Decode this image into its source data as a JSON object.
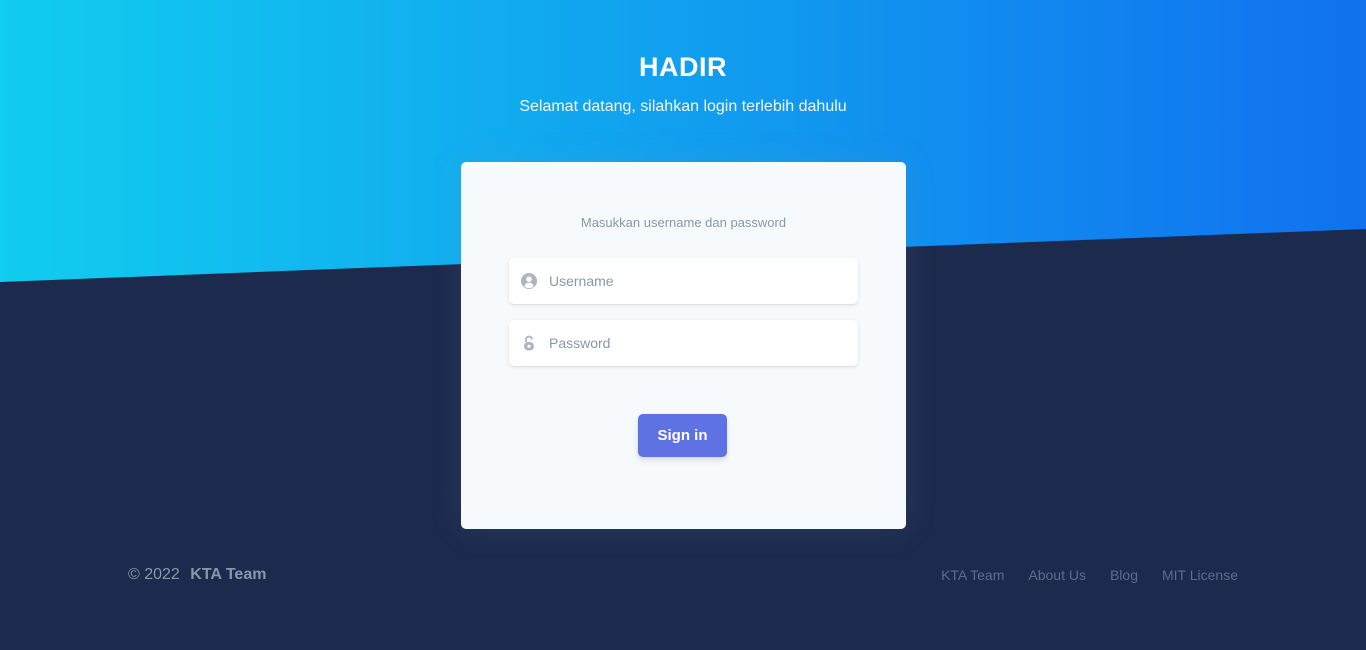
{
  "header": {
    "title": "HADIR",
    "subtitle": "Selamat datang, silahkan login terlebih dahulu"
  },
  "login": {
    "hint": "Masukkan username dan password",
    "username_placeholder": "Username",
    "password_placeholder": "Password",
    "signin_label": "Sign in"
  },
  "footer": {
    "copyright": "© 2022",
    "team": "KTA Team",
    "links": [
      {
        "label": "KTA Team"
      },
      {
        "label": "About Us"
      },
      {
        "label": "Blog"
      },
      {
        "label": "MIT License"
      }
    ]
  },
  "colors": {
    "gradient_start": "#11cdef",
    "gradient_end": "#1171ef",
    "background": "#1b2a4d",
    "button": "#5e72e4"
  },
  "icons": {
    "username": "user-circle-icon",
    "password": "lock-icon"
  }
}
